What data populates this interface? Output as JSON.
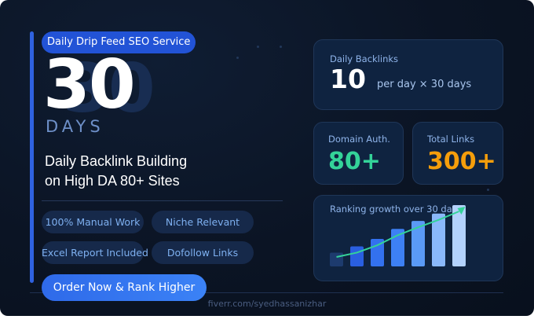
{
  "service_tag": "Daily Drip Feed SEO Service",
  "hero": {
    "number": "30",
    "unit": "DAYS",
    "headline_line1": "Daily Backlink Building",
    "headline_line2": "on High DA 80+ Sites"
  },
  "features": [
    "100% Manual Work",
    "Niche Relevant",
    "Excel Report Included",
    "Dofollow Links"
  ],
  "cta_label": "Order Now & Rank Higher",
  "footer_text": "fiverr.com/syedhassanizhar",
  "stats": {
    "daily_backlinks": {
      "label": "Daily Backlinks",
      "value": "10",
      "suffix": "per day × 30 days"
    },
    "domain_auth": {
      "label": "Domain Auth.",
      "value": "80+",
      "color": "#34d399"
    },
    "total_links": {
      "label": "Total Links",
      "value": "300+",
      "color": "#f59e0b"
    }
  },
  "growth": {
    "label": "Ranking growth over 30 days",
    "bar_levels": [
      0.26,
      0.38,
      0.52,
      0.71,
      0.86,
      1.0,
      1.16
    ],
    "bar_colors": [
      "#1d3b6e",
      "#2a5fe0",
      "#3371ef",
      "#3d80f4",
      "#5a9af6",
      "#8ab8fa",
      "#b3d2fd"
    ],
    "arrow_color": "#34d399"
  },
  "colors": {
    "background": "#0b1424",
    "accent": "#2f62e0",
    "card": "#0f2340"
  }
}
